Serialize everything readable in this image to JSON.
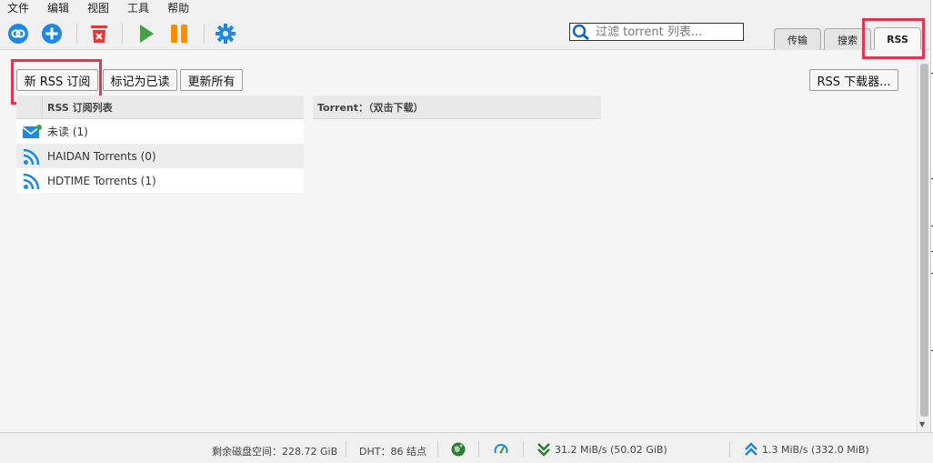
{
  "menubar": {
    "items": [
      {
        "label": "文件"
      },
      {
        "label": "编辑"
      },
      {
        "label": "视图"
      },
      {
        "label": "工具"
      },
      {
        "label": "帮助"
      }
    ]
  },
  "toolbar": {
    "icons": [
      "add-link-icon",
      "add-torrent-icon",
      "delete-icon",
      "resume-icon",
      "pause-icon",
      "settings-icon"
    ],
    "filter": {
      "placeholder": "过滤 torrent 列表...",
      "value": ""
    }
  },
  "tabs": [
    {
      "label": "传输",
      "active": false
    },
    {
      "label": "搜索",
      "active": false
    },
    {
      "label": "RSS",
      "active": true
    }
  ],
  "rss": {
    "buttons": {
      "new_subscription": "新 RSS 订阅",
      "mark_read": "标记为已读",
      "update_all": "更新所有",
      "downloader": "RSS 下载器..."
    },
    "feed_list_header": "RSS 订阅列表",
    "torrent_header": "Torrent：（双击下载）",
    "feeds": [
      {
        "label": "未读  (1)",
        "icon": "unread-mail-icon"
      },
      {
        "label": "HAIDAN Torrents (0)",
        "icon": "rss-feed-icon"
      },
      {
        "label": "HDTIME Torrents (1)",
        "icon": "rss-feed-icon"
      }
    ]
  },
  "statusbar": {
    "disk_free": "剩余磁盘空间：228.72 GiB",
    "dht": "DHT：86 结点",
    "download": "31.2 MiB/s (50.02 GiB)",
    "upload": "1.3 MiB/s (332.0 MiB)"
  },
  "colors": {
    "accent_blue": "#1e88e5",
    "delete_red": "#e53935",
    "resume_green": "#43a047",
    "pause_orange": "#fb8c00",
    "highlight_red": "#e8334f"
  }
}
